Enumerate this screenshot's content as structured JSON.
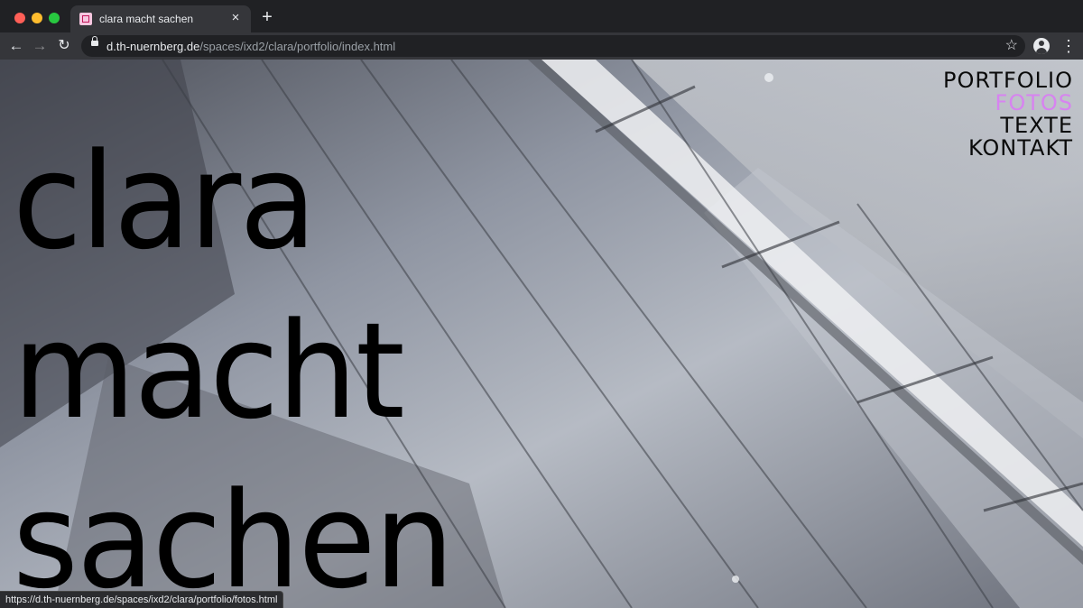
{
  "browser": {
    "tab": {
      "title": "clara macht sachen",
      "close_glyph": "×"
    },
    "new_tab_glyph": "+",
    "nav": {
      "back": "←",
      "forward": "→",
      "reload": "↻"
    },
    "url": {
      "host": "d.th-nuernberg.de",
      "path": "/spaces/ixd2/clara/portfolio/index.html"
    },
    "bookmark_glyph": "☆",
    "menu_glyph": "⋮",
    "status_url": "https://d.th-nuernberg.de/spaces/ixd2/clara/portfolio/fotos.html"
  },
  "site": {
    "nav": [
      {
        "label": "PORTFOLIO",
        "active": false
      },
      {
        "label": "FOTOS",
        "active": true
      },
      {
        "label": "TEXTE",
        "active": false
      },
      {
        "label": "KONTAKT",
        "active": false
      }
    ],
    "hero": [
      "clara",
      "macht",
      "sachen"
    ]
  },
  "colors": {
    "nav_active": "#d783f0",
    "text": "#0a0a0a"
  },
  "icons": [
    "lock-icon",
    "star-icon",
    "account-icon",
    "menu-icon",
    "favicon-icon"
  ]
}
